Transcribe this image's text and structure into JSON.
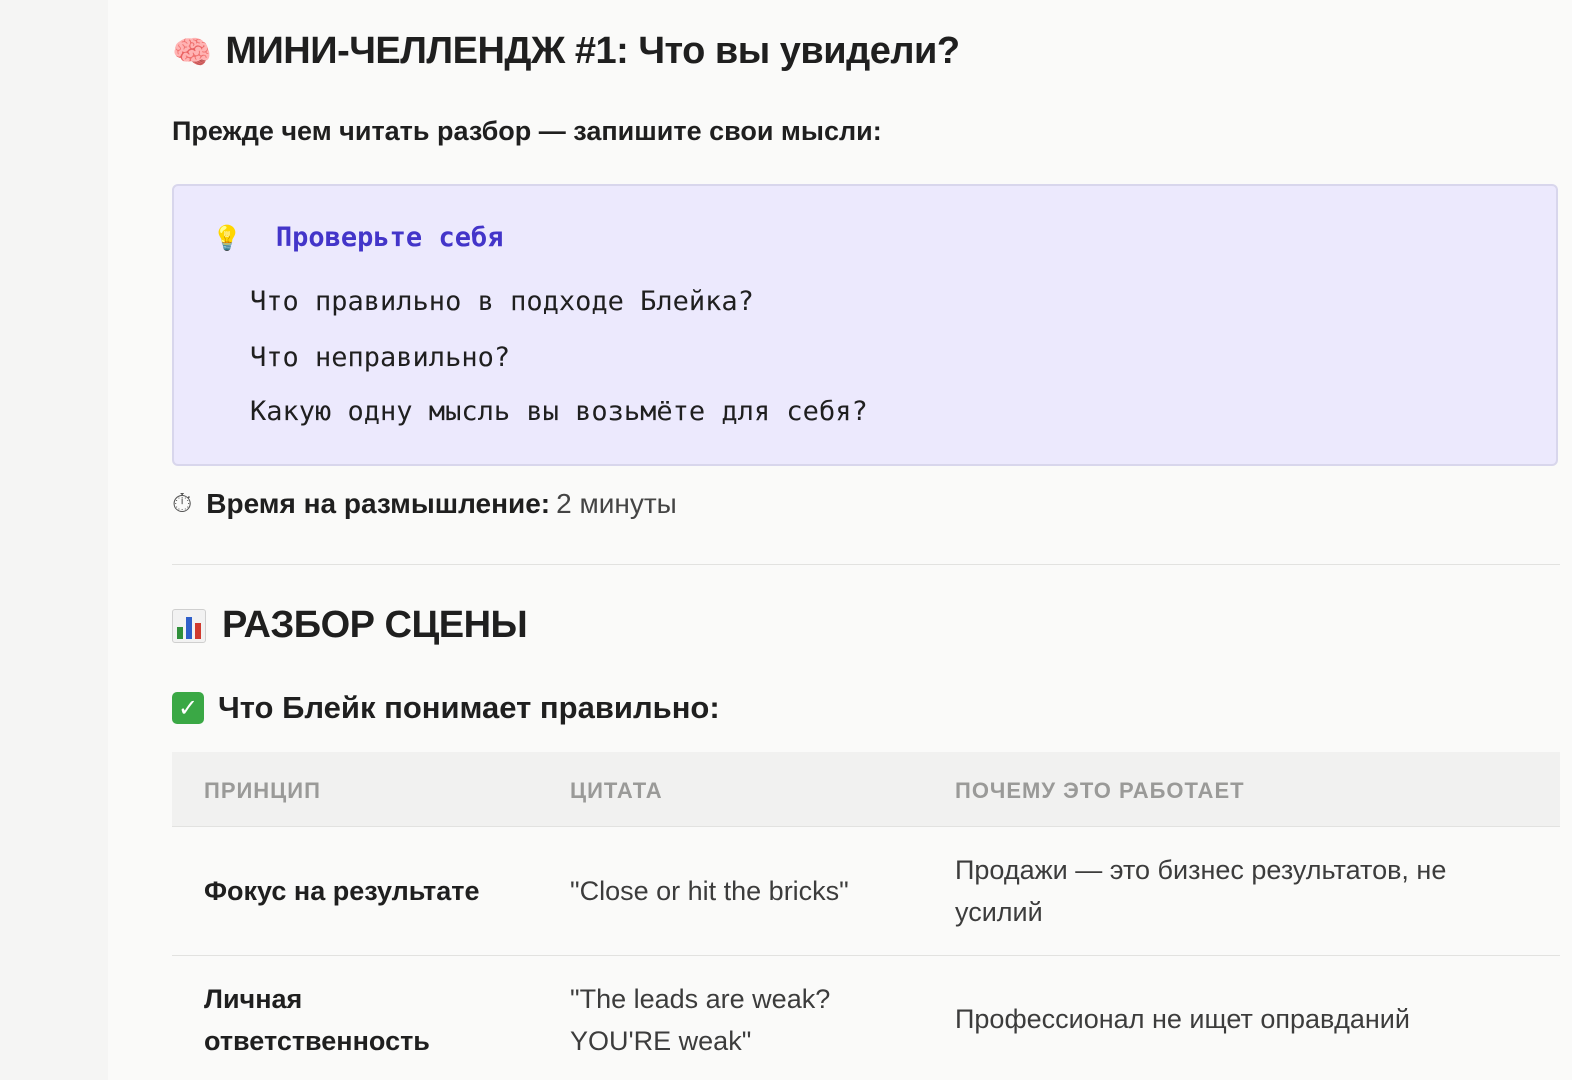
{
  "challenge": {
    "icon": "brain-icon",
    "title": "МИНИ-ЧЕЛЛЕНДЖ #1: Что вы увидели?",
    "intro": "Прежде чем читать разбор — запишите свои мысли:"
  },
  "callout": {
    "icon": "lightbulb-icon",
    "title": "Проверьте себя",
    "lines": [
      "Что правильно в подходе Блейка?",
      "Что неправильно?",
      "Какую одну мысль вы возьмёте для себя?"
    ],
    "background": "#ece9fd",
    "accent": "#4335c9"
  },
  "time": {
    "icon": "stopwatch-icon",
    "label": "Время на размышление:",
    "value": "2 минуты"
  },
  "analysis": {
    "icon": "bar-chart-icon",
    "title": "РАЗБОР СЦЕНЫ"
  },
  "section": {
    "icon": "check-mark-icon",
    "title": "Что Блейк понимает правильно:",
    "icon_color": "#3aa845"
  },
  "table": {
    "headers": [
      "ПРИНЦИП",
      "ЦИТАТА",
      "ПОЧЕМУ ЭТО РАБОТАЕТ"
    ],
    "rows": [
      {
        "principle": "Фокус на результате",
        "quote": "\"Close or hit the bricks\"",
        "why": "Продажи — это бизнес результатов, не усилий"
      },
      {
        "principle": "Личная ответственность",
        "quote": "\"The leads are weak? YOU'RE weak\"",
        "why": "Профессионал не ищет оправданий"
      }
    ]
  }
}
